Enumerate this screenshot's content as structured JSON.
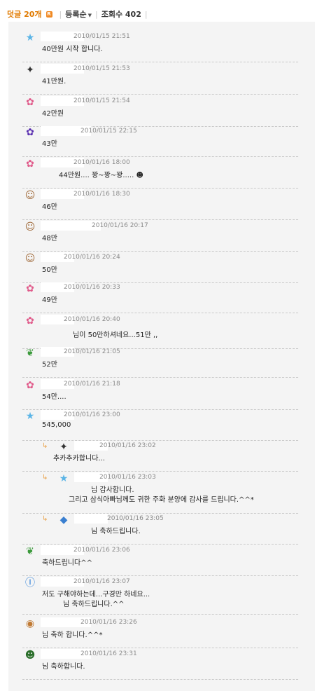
{
  "header": {
    "comment_count": "덧글 20개",
    "sort_label": "등록순",
    "views_label": "조회수 402"
  },
  "comments": [
    {
      "avatar": "star-icon",
      "date": "2010/01/15 21:51",
      "text": "40만원 시작 합니다."
    },
    {
      "avatar": "pixel-character-icon",
      "date": "2010/01/15 21:53",
      "text": "41만원."
    },
    {
      "avatar": "flower-icon",
      "date": "2010/01/15 21:54",
      "text": "42만원"
    },
    {
      "avatar": "purple-flower-icon",
      "date": "2010/01/15 22:15",
      "text": "43만"
    },
    {
      "avatar": "flower-icon",
      "date": "2010/01/16 18:00",
      "text": "44만원.... 꽝~꽝~꽝..... ☻"
    },
    {
      "avatar": "face-icon",
      "date": "2010/01/16 18:30",
      "text": "46만"
    },
    {
      "avatar": "face-icon",
      "date": "2010/01/16 20:17",
      "text": "48만"
    },
    {
      "avatar": "face-icon",
      "date": "2010/01/16 20:24",
      "text": "50만"
    },
    {
      "avatar": "flower-icon",
      "date": "2010/01/16 20:33",
      "text": "49만"
    },
    {
      "avatar": "flower-icon",
      "date": "2010/01/16 20:40",
      "text": "님이 50만하셔네요...51만 ,,"
    },
    {
      "avatar": "leaf-icon",
      "date": "2010/01/16 21:05",
      "text": "52만"
    },
    {
      "avatar": "flower-icon",
      "date": "2010/01/16 21:18",
      "text": "54만...."
    },
    {
      "avatar": "star-icon",
      "date": "2010/01/16 23:00",
      "text": "545,000"
    },
    {
      "avatar": "pixel-character-icon",
      "date": "2010/01/16 23:02",
      "text": "추카추카합니다...",
      "reply": true
    },
    {
      "avatar": "star-icon",
      "date": "2010/01/16 23:03",
      "text": "님 감사합니다.",
      "text2": "그리고 삼식아빠님께도 귀한 주화 분양에 감사를 드립니다.^^*",
      "reply": true
    },
    {
      "avatar": "fish-icon",
      "date": "2010/01/16 23:05",
      "text": "님 축하드립니다.",
      "reply": true
    },
    {
      "avatar": "leaf-icon",
      "date": "2010/01/16 23:06",
      "text": "축하드립니다^^"
    },
    {
      "avatar": "i-am-icon",
      "date": "2010/01/16 23:07",
      "text": "저도 구해야하는데...구경만 하네요...",
      "text2": "님 축하드립니다.^^"
    },
    {
      "avatar": "dog-icon",
      "date": "2010/01/16 23:26",
      "text": "님 축하 합니다.^^*"
    },
    {
      "avatar": "soldier-icon",
      "date": "2010/01/16 23:31",
      "text": "님 축하합니다."
    }
  ]
}
